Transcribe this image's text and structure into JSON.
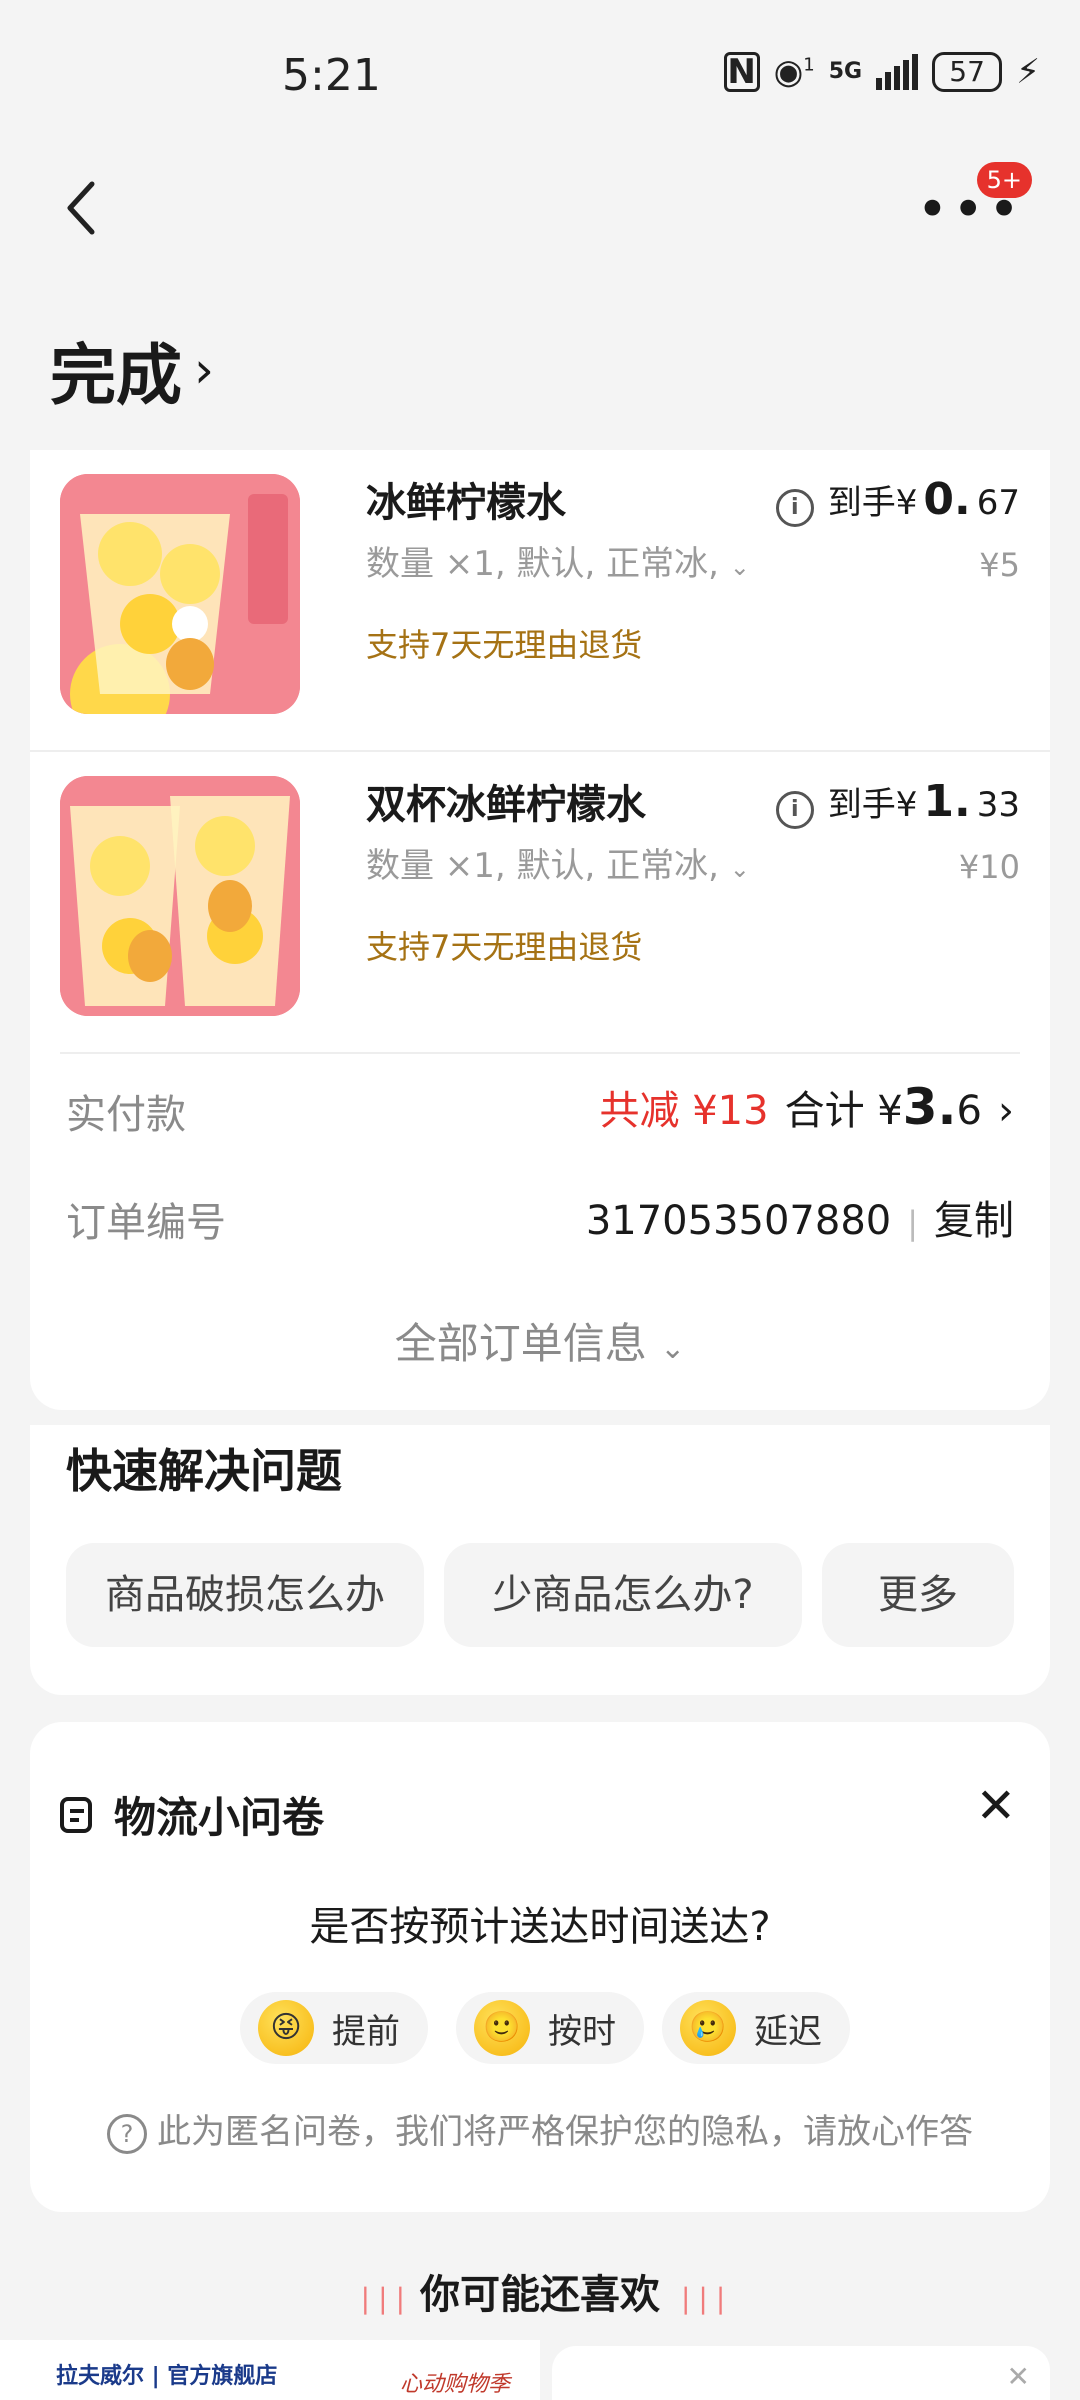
{
  "status": {
    "time": "5:21",
    "network": "5G",
    "signal_sup": "1",
    "battery": "57"
  },
  "nav": {
    "badge": "5+",
    "more": "•••"
  },
  "title": "完成",
  "items": [
    {
      "name": "冰鲜柠檬水",
      "spec": "数量 ×1, 默认, 正常冰,",
      "tag": "支持7天无理由退货",
      "price_prefix": "到手¥",
      "price_int": "0.",
      "price_dec": "67",
      "original": "¥5"
    },
    {
      "name": "双杯冰鲜柠檬水",
      "spec": "数量 ×1, 默认, 正常冰,",
      "tag": "支持7天无理由退货",
      "price_prefix": "到手¥",
      "price_int": "1.",
      "price_dec": "33",
      "original": "¥10"
    }
  ],
  "payment": {
    "label": "实付款",
    "discount": "共减 ¥13",
    "total_prefix": "合计 ¥",
    "total_int": "3.",
    "total_dec": "6"
  },
  "order": {
    "label": "订单编号",
    "number": "317053507880",
    "copy": "复制"
  },
  "all_info": "全部订单信息",
  "quick": {
    "title": "快速解决问题",
    "chips": [
      "商品破损怎么办",
      "少商品怎么办?",
      "更多"
    ]
  },
  "survey": {
    "title": "物流小问卷",
    "question": "是否按预计送达时间送达?",
    "options": [
      {
        "label": "提前"
      },
      {
        "label": "按时"
      },
      {
        "label": "延迟"
      }
    ],
    "privacy": "此为匿名问卷，我们将严格保护您的隐私，请放心作答"
  },
  "recommend": "你可能还喜欢",
  "bottom": {
    "brand": "拉夫威尔 | 官方旗舰店",
    "slogan": "心动购物季"
  }
}
